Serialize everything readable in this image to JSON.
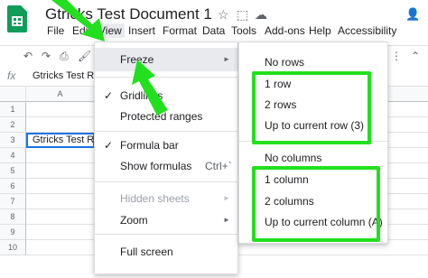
{
  "app": {
    "doc_title": "Gtricks Test Document 1",
    "title_icons": [
      "star-icon",
      "move-to-folder-icon",
      "cloud-status-icon"
    ],
    "user_icon_glyph": "👤",
    "brand_color": "#0f9d58"
  },
  "menubar": [
    {
      "label": "File",
      "active": false
    },
    {
      "label": "Edit",
      "active": false
    },
    {
      "label": "View",
      "active": true
    },
    {
      "label": "Insert",
      "active": false
    },
    {
      "label": "Format",
      "active": false
    },
    {
      "label": "Data",
      "active": false
    },
    {
      "label": "Tools",
      "active": false
    },
    {
      "label": "Add-ons",
      "active": false
    },
    {
      "label": "Help",
      "active": false
    },
    {
      "label": "Accessibility",
      "active": false
    }
  ],
  "toolbar": {
    "icons": [
      "undo-icon",
      "redo-icon",
      "print-icon",
      "paint-format-icon"
    ],
    "right_icons": [
      "more-icon",
      "collapse-icon"
    ]
  },
  "formula_bar": {
    "fx_label": "fx",
    "cell_value": "Gtricks Test Ro"
  },
  "grid": {
    "columns": [
      "A"
    ],
    "rows": [
      "1",
      "2",
      "3",
      "4",
      "5",
      "6",
      "7",
      "8",
      "9",
      "10"
    ],
    "cell_text": "Gtricks Test Ro"
  },
  "view_menu": {
    "items": [
      {
        "label": "Freeze",
        "checked": false,
        "submenu": true,
        "disabled": false,
        "highlighted": true,
        "shortcut": ""
      },
      {
        "label": "Gridlines",
        "checked": true,
        "submenu": false,
        "disabled": false,
        "highlighted": false,
        "shortcut": ""
      },
      {
        "label": "Protected ranges",
        "checked": false,
        "submenu": false,
        "disabled": false,
        "highlighted": false,
        "shortcut": ""
      },
      {
        "label": "Formula bar",
        "checked": true,
        "submenu": false,
        "disabled": false,
        "highlighted": false,
        "shortcut": ""
      },
      {
        "label": "Show formulas",
        "checked": false,
        "submenu": false,
        "disabled": false,
        "highlighted": false,
        "shortcut": "Ctrl+`"
      },
      {
        "label": "Hidden sheets",
        "checked": false,
        "submenu": true,
        "disabled": true,
        "highlighted": false,
        "shortcut": ""
      },
      {
        "label": "Zoom",
        "checked": false,
        "submenu": true,
        "disabled": false,
        "highlighted": false,
        "shortcut": ""
      },
      {
        "label": "Full screen",
        "checked": false,
        "submenu": false,
        "disabled": false,
        "highlighted": false,
        "shortcut": ""
      }
    ]
  },
  "freeze_menu": {
    "rows": {
      "none": "No rows",
      "one": "1 row",
      "two": "2 rows",
      "up_to_current": "Up to current row (3)"
    },
    "columns": {
      "none": "No columns",
      "one": "1 column",
      "two": "2 columns",
      "up_to_current": "Up to current column (A)"
    }
  },
  "annotations": {
    "highlight_color": "#22e01e"
  }
}
